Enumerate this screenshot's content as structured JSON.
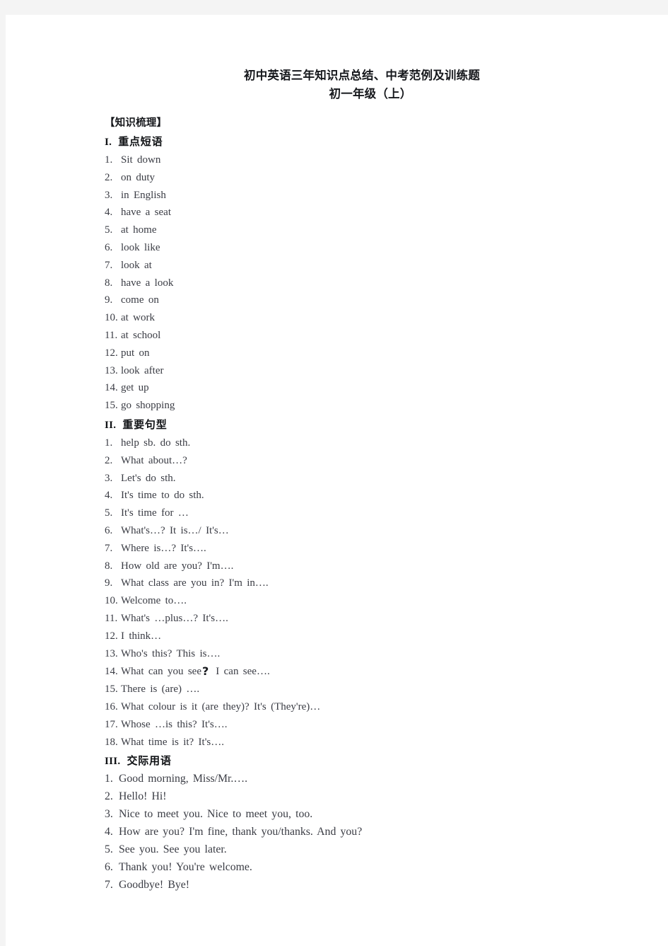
{
  "document": {
    "title": "初中英语三年知识点总结、中考范例及训练题",
    "subtitle": "初一年级（上）",
    "bracket_heading": "【知识梳理】"
  },
  "sections": [
    {
      "numeral": "I.",
      "label": "重点短语",
      "items": [
        {
          "num": "1.",
          "text": "Sit down"
        },
        {
          "num": "2.",
          "text": "on duty"
        },
        {
          "num": "3.",
          "text": "in English"
        },
        {
          "num": "4.",
          "text": "have a seat"
        },
        {
          "num": "5.",
          "text": "at home"
        },
        {
          "num": "6.",
          "text": "look like"
        },
        {
          "num": "7.",
          "text": "look at"
        },
        {
          "num": "8.",
          "text": "have a look"
        },
        {
          "num": "9.",
          "text": "come on"
        },
        {
          "num": "10.",
          "text": "at work"
        },
        {
          "num": "11.",
          "text": "at school"
        },
        {
          "num": "12.",
          "text": "put on"
        },
        {
          "num": "13.",
          "text": "look after"
        },
        {
          "num": "14.",
          "text": "get up"
        },
        {
          "num": "15.",
          "text": "go shopping"
        }
      ]
    },
    {
      "numeral": "II.",
      "label": "重要句型",
      "items": [
        {
          "num": "1.",
          "text": "help sb. do sth."
        },
        {
          "num": "2.",
          "text": "What about…?"
        },
        {
          "num": "3.",
          "text": "Let's do sth."
        },
        {
          "num": "4.",
          "text": "It's time to do sth."
        },
        {
          "num": "5.",
          "text": "It's time for …"
        },
        {
          "num": "6.",
          "text": "What's…? It is…/ It's…"
        },
        {
          "num": "7.",
          "text": "Where is…? It's…."
        },
        {
          "num": "8.",
          "text": "How old are you? I'm…."
        },
        {
          "num": "9.",
          "text": "What class are you in? I'm in…."
        },
        {
          "num": "10.",
          "text": "Welcome to…."
        },
        {
          "num": "11.",
          "text": "What's …plus…? It's…."
        },
        {
          "num": "12.",
          "text": "I think…"
        },
        {
          "num": "13.",
          "text": "Who's this? This is…."
        },
        {
          "num": "14.",
          "text_before": "What can you see",
          "big_question_mark": "?",
          "text_after": "I can see…."
        },
        {
          "num": "15.",
          "text": "There is (are) …."
        },
        {
          "num": "16.",
          "text": "What colour is it (are they)? It's (They're)…"
        },
        {
          "num": "17.",
          "text": "Whose …is this? It's…."
        },
        {
          "num": "18.",
          "text": "What time is it? It's…."
        }
      ]
    },
    {
      "numeral": "III.",
      "label": "交际用语",
      "items": [
        {
          "num": "1.",
          "text": "Good morning, Miss/Mr.…."
        },
        {
          "num": "2.",
          "text": "Hello! Hi!"
        },
        {
          "num": "3.",
          "text": "Nice to meet you. Nice to meet you, too."
        },
        {
          "num": "4.",
          "text": "How are you? I'm fine, thank you/thanks. And you?"
        },
        {
          "num": "5.",
          "text": "See you. See you later."
        },
        {
          "num": "6.",
          "text": "Thank you! You're welcome."
        },
        {
          "num": "7.",
          "text": "Goodbye! Bye!"
        }
      ]
    }
  ],
  "colors": {
    "page_background": "#ffffff",
    "canvas_background": "#f4f4f4",
    "body_text": "#3a3c44",
    "heading_text": "#101215"
  }
}
